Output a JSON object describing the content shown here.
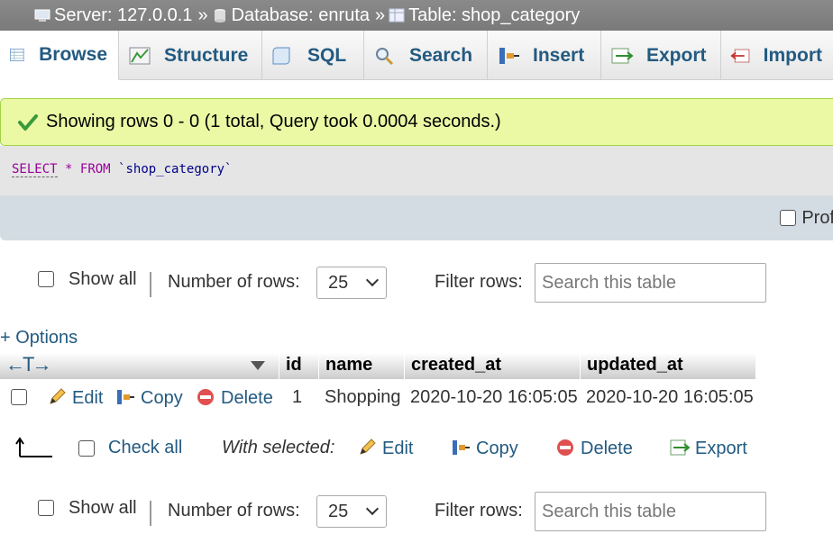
{
  "breadcrumb": {
    "server": "Server: 127.0.0.1",
    "database": "Database: enruta",
    "table": "Table: shop_category",
    "separator": "»"
  },
  "tabs": [
    {
      "label": "Browse",
      "icon": "browse-icon",
      "active": true
    },
    {
      "label": "Structure",
      "icon": "structure-icon"
    },
    {
      "label": "SQL",
      "icon": "sql-icon"
    },
    {
      "label": "Search",
      "icon": "search-icon"
    },
    {
      "label": "Insert",
      "icon": "insert-icon"
    },
    {
      "label": "Export",
      "icon": "export-icon"
    },
    {
      "label": "Import",
      "icon": "import-icon"
    }
  ],
  "message": {
    "text": "Showing rows 0 - 0 (1 total, Query took 0.0004 seconds.)",
    "icon": "check-icon",
    "color": "#ebf8a4"
  },
  "query": {
    "select": "SELECT",
    "star": "*",
    "from": "FROM",
    "table": "`shop_category`"
  },
  "profiling": {
    "label": "Prof"
  },
  "navigation": {
    "show_all": "Show all",
    "number_of_rows_label": "Number of rows:",
    "rows_value": "25",
    "filter_label": "Filter rows:",
    "filter_placeholder": "Search this table"
  },
  "options_link": "+ Options",
  "table": {
    "columns": [
      "id",
      "name",
      "created_at",
      "updated_at"
    ],
    "rows": [
      {
        "edit": "Edit",
        "copy": "Copy",
        "delete": "Delete",
        "id": "1",
        "name": "Shopping",
        "created_at": "2020-10-20 16:05:05",
        "updated_at": "2020-10-20 16:05:05"
      }
    ]
  },
  "with_selected": {
    "check_all": "Check all",
    "label": "With selected:",
    "edit": "Edit",
    "copy": "Copy",
    "delete": "Delete",
    "export": "Export"
  },
  "colors": {
    "link": "#235a81",
    "breadcrumb_bg": "#808080",
    "profiling_bg": "#d3dce3"
  }
}
